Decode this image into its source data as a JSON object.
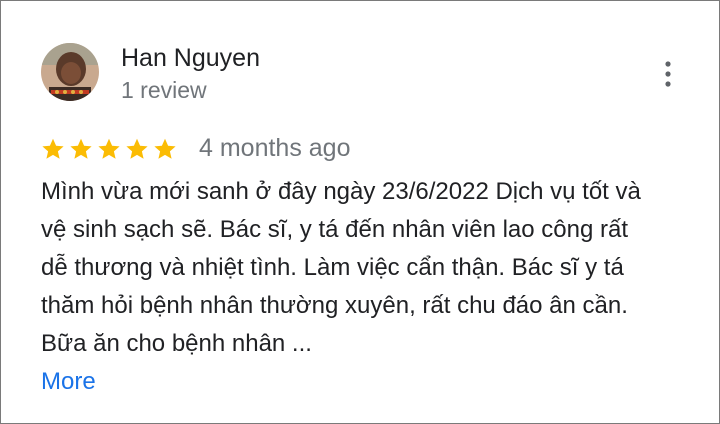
{
  "review": {
    "author": {
      "name": "Han Nguyen",
      "meta": "1 review",
      "avatar_icon": "user-photo-avatar"
    },
    "menu_icon": "more-vert-icon",
    "rating": 5,
    "max_rating": 5,
    "star_color": "#fbbc04",
    "date": "4 months ago",
    "text_lines": [
      "Mình vừa mới sanh ở đây ngày 23/6/2022 Dịch vụ tốt và",
      "vệ sinh sạch sẽ. Bác sĩ, y tá đến nhân viên lao công rất",
      "dễ thương và nhiệt tình. Làm việc cẩn thận. Bác sĩ y tá",
      "thăm hỏi bệnh nhân thường xuyên, rất chu đáo ân cần.",
      "Bữa ăn cho bệnh nhân ..."
    ],
    "more_label": "More",
    "link_color": "#1a73e8"
  }
}
